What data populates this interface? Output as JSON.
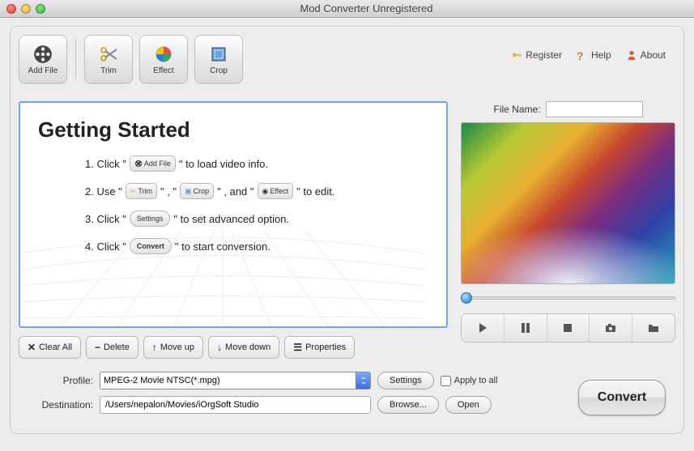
{
  "window": {
    "title": "Mod Converter Unregistered"
  },
  "toolbar": {
    "add_file": "Add File",
    "trim": "Trim",
    "effect": "Effect",
    "crop": "Crop"
  },
  "header_links": {
    "register": "Register",
    "help": "Help",
    "about": "About"
  },
  "getting_started": {
    "title": "Getting Started",
    "step1_a": "1. Click \"",
    "step1_b": "\" to load video info.",
    "step2_a": "2. Use \"",
    "step2_b": "\" , \"",
    "step2_c": "\" , and \"",
    "step2_d": "\" to edit.",
    "step3_a": "3. Click \"",
    "step3_b": "\" to set advanced option.",
    "step4_a": "4. Click \"",
    "step4_b": "\" to start conversion.",
    "mini_addfile": "Add File",
    "mini_trim": "Trim",
    "mini_crop": "Crop",
    "mini_effect": "Effect",
    "mini_settings": "Settings",
    "mini_convert": "Convert"
  },
  "file_buttons": {
    "clear_all": "Clear All",
    "delete": "Delete",
    "move_up": "Move up",
    "move_down": "Move down",
    "properties": "Properties"
  },
  "preview": {
    "file_name_label": "File Name:",
    "file_name_value": ""
  },
  "bottom": {
    "profile_label": "Profile:",
    "profile_value": "MPEG-2 Movie NTSC(*.mpg)",
    "settings": "Settings",
    "apply_all": "Apply to all",
    "destination_label": "Destination:",
    "destination_value": "/Users/nepalon/Movies/iOrgSoft Studio",
    "browse": "Browse...",
    "open": "Open",
    "convert": "Convert"
  }
}
